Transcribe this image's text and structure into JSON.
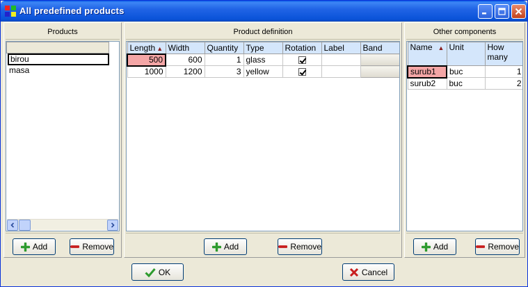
{
  "window": {
    "title": "All predefined products"
  },
  "products_panel": {
    "header": "Products",
    "items": [
      "birou",
      "masa"
    ],
    "add_label": "Add",
    "remove_label": "Remove"
  },
  "definition_panel": {
    "header": "Product definition",
    "columns": [
      "Length",
      "Width",
      "Quantity",
      "Type",
      "Rotation",
      "Label",
      "Band"
    ],
    "rows": [
      {
        "length": "500",
        "width": "600",
        "quantity": "1",
        "type": "glass",
        "rotation": true,
        "label": "",
        "band": ""
      },
      {
        "length": "1000",
        "width": "1200",
        "quantity": "3",
        "type": "yellow",
        "rotation": true,
        "label": "",
        "band": ""
      }
    ],
    "add_label": "Add",
    "remove_label": "Remove"
  },
  "components_panel": {
    "header": "Other components",
    "columns": [
      "Name",
      "Unit",
      "How many"
    ],
    "rows": [
      {
        "name": "surub1",
        "unit": "buc",
        "how_many": "1"
      },
      {
        "name": "surub2",
        "unit": "buc",
        "how_many": "2"
      }
    ],
    "add_label": "Add",
    "remove_label": "Remove"
  },
  "dialog": {
    "ok_label": "OK",
    "cancel_label": "Cancel"
  },
  "colors": {
    "titlebar": "#2164e6",
    "selected_cell": "#f4a6a6",
    "header_bg": "#d4e6fb",
    "add_icon": "#2e9b2e",
    "remove_icon": "#c81e1e",
    "ok_icon": "#2e9b2e",
    "cancel_icon": "#c81e1e"
  },
  "icons": {
    "app": "app-grid-icon",
    "minimize": "minimize-icon",
    "maximize": "maximize-icon",
    "close": "close-icon",
    "add": "plus-icon",
    "remove": "minus-icon",
    "ok": "checkmark-icon",
    "cancel": "x-icon"
  }
}
